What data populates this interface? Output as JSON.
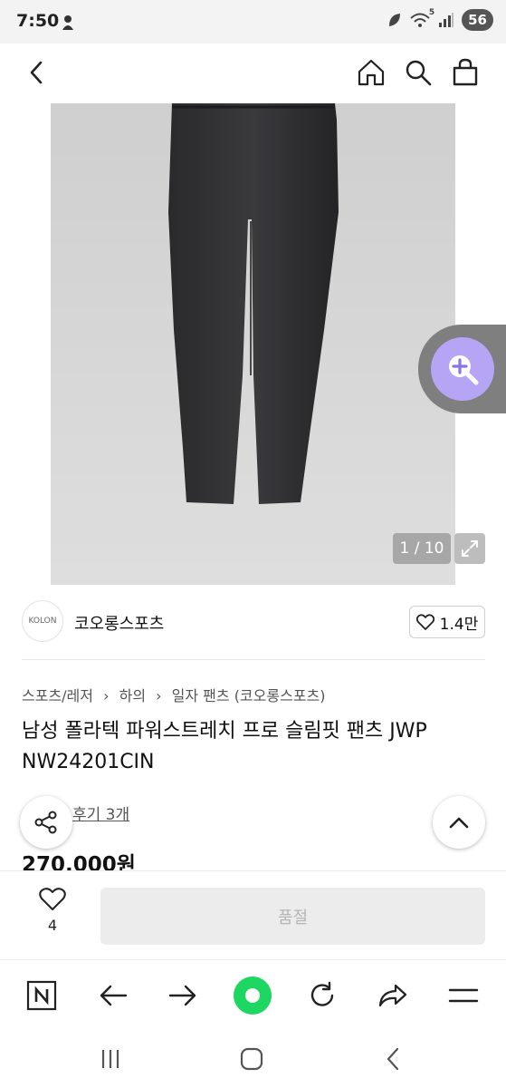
{
  "status_bar": {
    "time": "7:50",
    "battery_level": "56",
    "network": "5"
  },
  "top_nav": {
    "icons": [
      "back-arrow-icon",
      "home-icon",
      "search-icon",
      "shopping-bag-icon"
    ]
  },
  "gallery": {
    "counter": "1 / 10"
  },
  "brand": {
    "name": "코오롱스포츠",
    "logo_text": "KOLON",
    "likes": "1.4만"
  },
  "product": {
    "breadcrumb": [
      "스포츠/레저",
      "하의",
      "일자 팬츠 (코오롱스포츠)"
    ],
    "title": "남성 폴라텍 파워스트레치 프로 슬림핏 팬츠 JWP NW24201CIN",
    "review": "후기 3개",
    "price": "270,000원"
  },
  "purchase_bar": {
    "wish_count": "4",
    "buy_label": "품절"
  },
  "browser_bar": {
    "icons": [
      "naver-n-icon",
      "back-icon",
      "forward-icon",
      "green-dot-icon",
      "refresh-icon",
      "share-icon",
      "menu-icon"
    ]
  },
  "colors": {
    "zoom_accent": "#b6a4f5",
    "browser_green": "#1ed760",
    "image_bg": "#d4d4d4"
  }
}
